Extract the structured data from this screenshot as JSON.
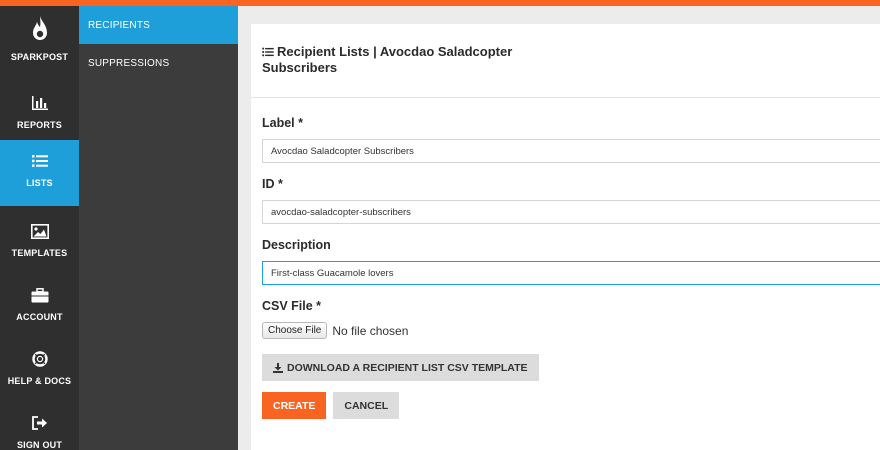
{
  "colors": {
    "accent_orange": "#fa6423",
    "active_blue": "#1e9fd9",
    "nav_bg": "#2f2f2f",
    "subnav_bg": "#3c3c3c"
  },
  "nav": {
    "logo": {
      "label": "SPARKPOST",
      "icon": "flame-icon"
    },
    "items": [
      {
        "label": "REPORTS",
        "icon": "bar-chart-icon",
        "active": false
      },
      {
        "label": "LISTS",
        "icon": "list-icon",
        "active": true
      },
      {
        "label": "TEMPLATES",
        "icon": "image-icon",
        "active": false
      },
      {
        "label": "ACCOUNT",
        "icon": "briefcase-icon",
        "active": false
      },
      {
        "label": "HELP & DOCS",
        "icon": "life-ring-icon",
        "active": false
      },
      {
        "label": "SIGN OUT",
        "icon": "sign-out-icon",
        "active": false
      }
    ]
  },
  "subnav": {
    "items": [
      {
        "label": "RECIPIENTS",
        "active": true
      },
      {
        "label": "SUPPRESSIONS",
        "active": false
      }
    ]
  },
  "panel": {
    "title": "Recipient Lists | Avocdao Saladcopter Subscribers",
    "title_icon": "list-icon"
  },
  "form": {
    "label": {
      "label": "Label *",
      "value": "Avocdao Saladcopter Subscribers"
    },
    "id": {
      "label": "ID *",
      "value": "avocdao-saladcopter-subscribers"
    },
    "description": {
      "label": "Description",
      "value": "First-class Guacamole lovers"
    },
    "csv": {
      "label": "CSV File *",
      "button": "Choose File",
      "status": "No file chosen"
    },
    "download_button": "DOWNLOAD A RECIPIENT LIST CSV TEMPLATE",
    "download_icon": "download-icon",
    "create_button": "CREATE",
    "cancel_button": "CANCEL"
  }
}
